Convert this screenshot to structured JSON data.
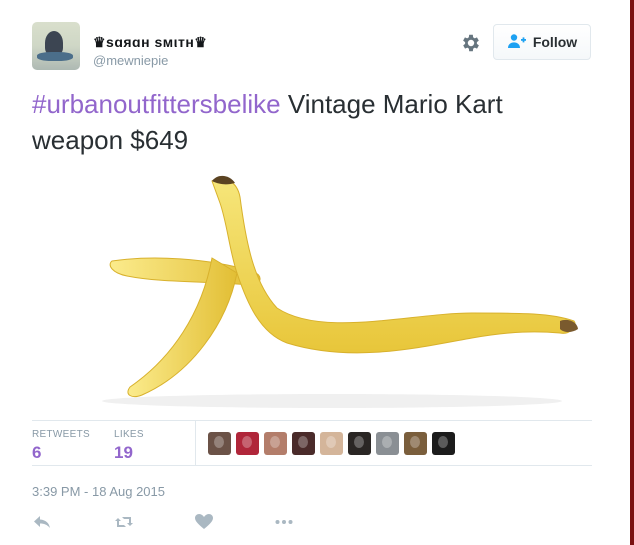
{
  "tweet": {
    "display_name": "♛sɑяɑн sмιтн♛",
    "handle": "@mewniepie",
    "follow_label": "Follow",
    "text_hashtag": "#urbanoutfittersbelike",
    "text_body": " Vintage Mario Kart weapon $649",
    "media_subject": "banana peel",
    "retweets_label": "RETWEETS",
    "retweets_count": "6",
    "likes_label": "LIKES",
    "likes_count": "19",
    "timestamp": "3:39 PM - 18 Aug 2015"
  },
  "likers": [
    {
      "color": "#6b5247"
    },
    {
      "color": "#b0263a"
    },
    {
      "color": "#b37d6a"
    },
    {
      "color": "#4a2b2a"
    },
    {
      "color": "#d4b59a"
    },
    {
      "color": "#2a2624"
    },
    {
      "color": "#8a8f94"
    },
    {
      "color": "#7a5e3c"
    },
    {
      "color": "#1c1c1c"
    }
  ],
  "colors": {
    "accent": "#9266cc",
    "text": "#292f33",
    "muted": "#8899a6"
  },
  "icons": [
    "gear-icon",
    "follow-person-plus-icon",
    "reply-icon",
    "retweet-icon",
    "like-heart-icon",
    "more-dots-icon"
  ]
}
